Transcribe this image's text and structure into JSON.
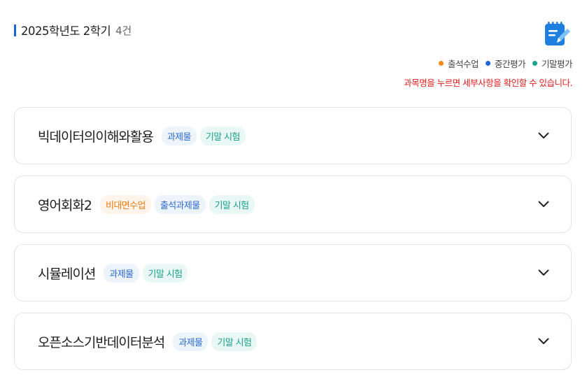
{
  "header": {
    "title": "2025학년도 2학기",
    "count": "4건"
  },
  "legend": {
    "items": [
      {
        "label": "출석수업",
        "color": "#f28a1b"
      },
      {
        "label": "중간평가",
        "color": "#1a66d9"
      },
      {
        "label": "기말평가",
        "color": "#18a392"
      }
    ]
  },
  "hint": "과목명을 누르면 세부사항을 확인할 수 있습니다.",
  "courses": [
    {
      "name": "빅데이터의이해와활용",
      "tags": [
        {
          "label": "과제물",
          "type": "blue"
        },
        {
          "label": "기말 시험",
          "type": "teal"
        }
      ]
    },
    {
      "name": "영어회화2",
      "tags": [
        {
          "label": "비대면수업",
          "type": "orange"
        },
        {
          "label": "출석과제물",
          "type": "blue"
        },
        {
          "label": "기말 시험",
          "type": "teal"
        }
      ]
    },
    {
      "name": "시뮬레이션",
      "tags": [
        {
          "label": "과제물",
          "type": "blue"
        },
        {
          "label": "기말 시험",
          "type": "teal"
        }
      ]
    },
    {
      "name": "오픈소스기반데이터분석",
      "tags": [
        {
          "label": "과제물",
          "type": "blue"
        },
        {
          "label": "기말 시험",
          "type": "teal"
        }
      ]
    }
  ],
  "icons": {
    "header_icon": "notepad-pencil-icon",
    "expand_icon": "chevron-down-icon"
  }
}
